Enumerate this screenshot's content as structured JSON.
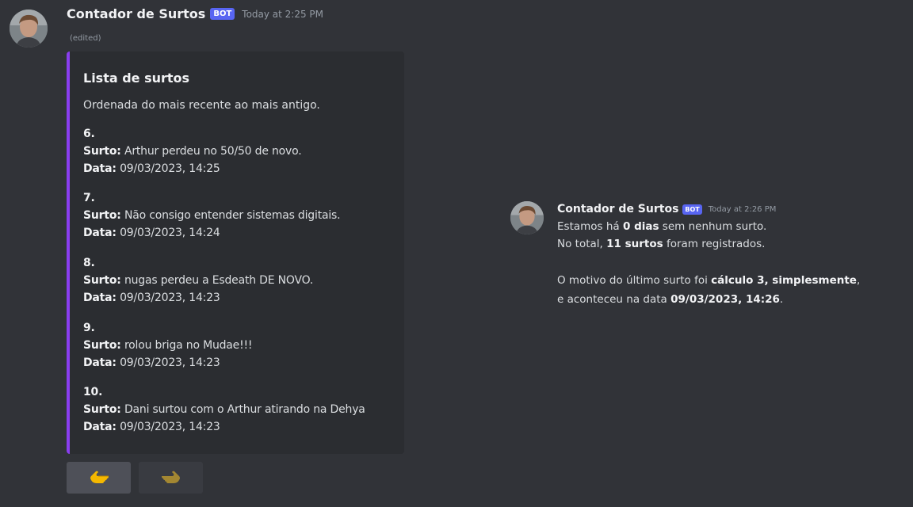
{
  "message1": {
    "author": "Contador de Surtos",
    "bot_tag": "BOT",
    "timestamp": "Today at 2:25 PM",
    "edited": "(edited)",
    "embed": {
      "accent_color": "#8a3ef0",
      "title": "Lista de surtos",
      "description": "Ordenada do mais recente ao mais antigo.",
      "entries": [
        {
          "number": "6.",
          "surto_label": "Surto:",
          "surto": "Arthur perdeu no 50/50 de novo.",
          "data_label": "Data:",
          "data": "09/03/2023, 14:25"
        },
        {
          "number": "7.",
          "surto_label": "Surto:",
          "surto": "Não consigo entender sistemas digitais.",
          "data_label": "Data:",
          "data": "09/03/2023, 14:24"
        },
        {
          "number": "8.",
          "surto_label": "Surto:",
          "surto": "nugas perdeu a Esdeath DE NOVO.",
          "data_label": "Data:",
          "data": "09/03/2023, 14:23"
        },
        {
          "number": "9.",
          "surto_label": "Surto:",
          "surto": "rolou briga no Mudae!!!",
          "data_label": "Data:",
          "data": "09/03/2023, 14:23"
        },
        {
          "number": "10.",
          "surto_label": "Surto:",
          "surto": "Dani surtou com o Arthur atirando na Dehya",
          "data_label": "Data:",
          "data": "09/03/2023, 14:23"
        }
      ]
    },
    "buttons": [
      {
        "icon": "point-left-icon"
      },
      {
        "icon": "point-right-icon"
      }
    ]
  },
  "message2": {
    "author": "Contador de Surtos",
    "bot_tag": "BOT",
    "timestamp": "Today at 2:26 PM",
    "line1": {
      "pre": "Estamos há ",
      "bold": "0 dias",
      "post": " sem nenhum surto."
    },
    "line2": {
      "pre": "No total, ",
      "bold": "11 surtos",
      "post": " foram registrados."
    },
    "line3": {
      "pre": "O motivo do último surto foi ",
      "bold": "cálculo 3, simplesmente",
      "post": ","
    },
    "line4": {
      "pre": "e aconteceu na data ",
      "bold": "09/03/2023, 14:26",
      "post": "."
    }
  },
  "colors": {
    "background": "#313338",
    "embed_background": "#2b2d31",
    "bot_tag": "#5865f2"
  }
}
